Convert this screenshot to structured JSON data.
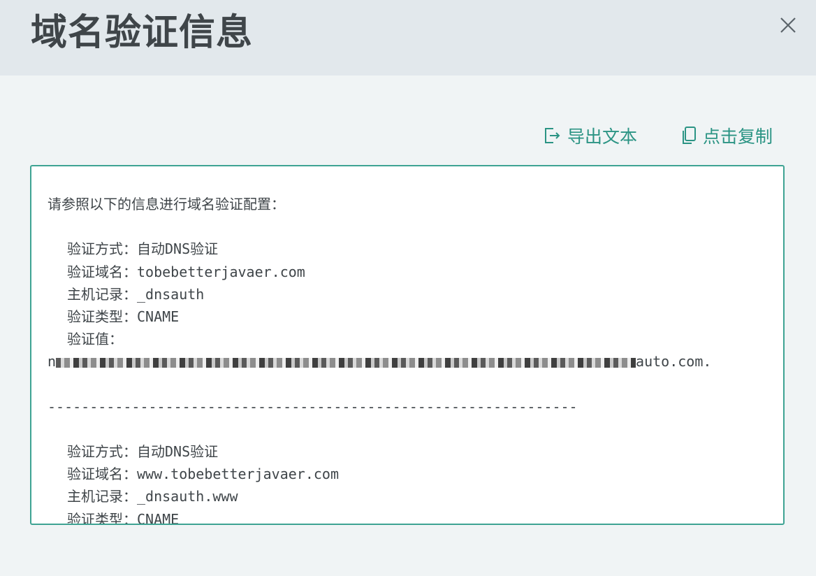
{
  "dialog": {
    "title": "域名验证信息",
    "close_icon": "close-icon"
  },
  "actions": {
    "export": {
      "icon": "export-icon",
      "label": "导出文本"
    },
    "copy": {
      "icon": "copy-icon",
      "label": "点击复制"
    }
  },
  "content": {
    "intro": "请参照以下的信息进行域名验证配置：",
    "entries": [
      {
        "method_label": "验证方式：",
        "method": "自动DNS验证",
        "domain_label": "验证域名：",
        "domain": "tobebetterjavaer.com",
        "host_label": "主机记录：",
        "host": "_dnsauth",
        "type_label": "验证类型：",
        "type": "CNAME",
        "value_label": "验证值：",
        "value_prefix": "n",
        "value_suffix": "auto.com."
      },
      {
        "method_label": "验证方式：",
        "method": "自动DNS验证",
        "domain_label": "验证域名：",
        "domain": "www.tobebetterjavaer.com",
        "host_label": "主机记录：",
        "host": "_dnsauth.www",
        "type_label": "验证类型：",
        "type": "CNAME"
      }
    ],
    "separator": "---------------------------------------------------------------"
  },
  "colors": {
    "accent": "#2b9484",
    "border": "#3ea393",
    "header_bg": "#e2e8ec",
    "body_bg": "#f0f4f5",
    "text": "#3f4549"
  }
}
